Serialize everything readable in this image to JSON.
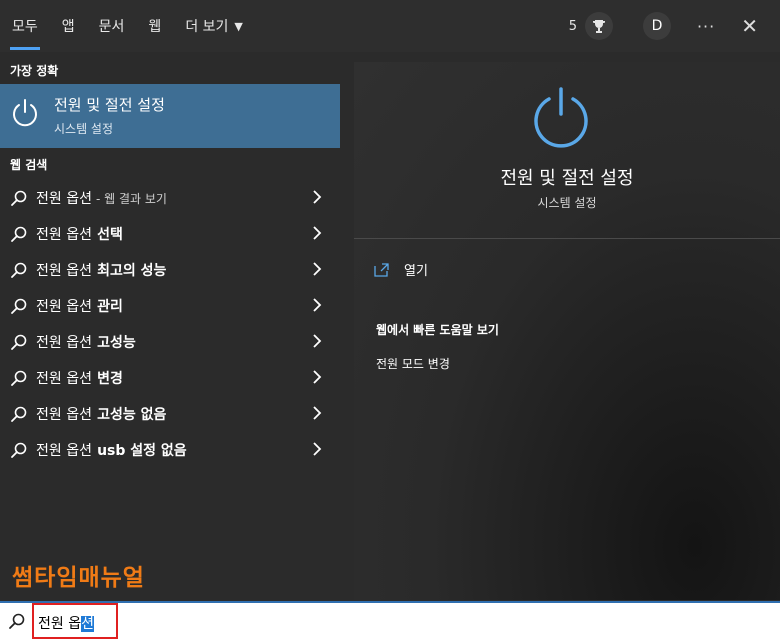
{
  "tabs": [
    {
      "label": "모두",
      "active": true
    },
    {
      "label": "앱",
      "active": false
    },
    {
      "label": "문서",
      "active": false
    },
    {
      "label": "웹",
      "active": false
    },
    {
      "label": "더 보기",
      "active": false
    }
  ],
  "toolbar": {
    "points": "5",
    "avatar_letter": "D",
    "more": "···",
    "close": "✕"
  },
  "best_match": {
    "section": "가장 정확",
    "title": "전원 및 절전 설정",
    "subtitle": "시스템 설정"
  },
  "web_search": {
    "section": "웹 검색",
    "items": [
      {
        "prefix": "전원 옵션",
        "suffix": "- 웹 결과 보기",
        "bold": ""
      },
      {
        "prefix": "전원 옵션",
        "suffix": "",
        "bold": "선택"
      },
      {
        "prefix": "전원 옵션",
        "suffix": "",
        "bold": "최고의 성능"
      },
      {
        "prefix": "전원 옵션",
        "suffix": "",
        "bold": "관리"
      },
      {
        "prefix": "전원 옵션",
        "suffix": "",
        "bold": "고성능"
      },
      {
        "prefix": "전원 옵션",
        "suffix": "",
        "bold": "변경"
      },
      {
        "prefix": "전원 옵션",
        "suffix": "",
        "bold": "고성능 없음"
      },
      {
        "prefix": "전원 옵션",
        "suffix": "",
        "bold": "usb 설정 없음"
      }
    ]
  },
  "watermark": "썸타임매뉴얼",
  "preview": {
    "title": "전원 및 절전 설정",
    "subtitle": "시스템 설정",
    "open_label": "열기",
    "help_title": "웹에서 빠른 도움말 보기",
    "help_link": "전원 모드 변경"
  },
  "search": {
    "text_plain": "전원 옵",
    "text_selected": "션"
  },
  "colors": {
    "accent": "#4ea1f3",
    "best_bg": "#3e6e94",
    "highlight_box": "#e02020",
    "watermark": "#f07b16"
  }
}
